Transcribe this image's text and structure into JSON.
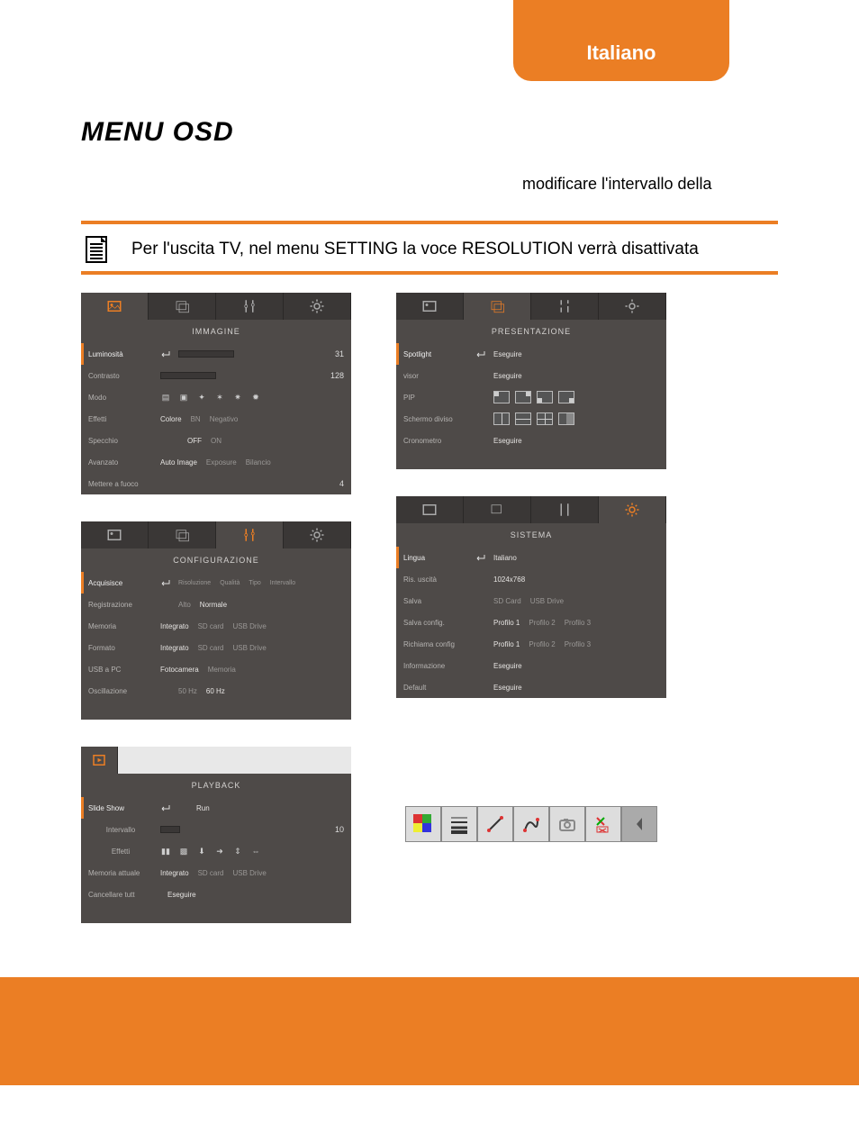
{
  "header": {
    "lang": "Italiano",
    "title": "MENU OSD",
    "rtext": "modificare l'intervallo della"
  },
  "info": {
    "text": "Per l'uscita TV, nel menu SETTING la voce RESOLUTION verrà disattivata"
  },
  "immagine": {
    "title": "IMMAGINE",
    "labels": {
      "lum": "Luminosità",
      "con": "Contrasto",
      "modo": "Modo",
      "eff": "Effetti",
      "spec": "Specchio",
      "av": "Avanzato",
      "foc": "Mettere a fuoco"
    },
    "vals": {
      "lum": "31",
      "con": "128",
      "eff": [
        "Colore",
        "BN",
        "Negativo"
      ],
      "spec": [
        "OFF",
        "ON"
      ],
      "av": [
        "Auto Image",
        "Exposure",
        "Bilancio"
      ],
      "foc": "4"
    }
  },
  "presentazione": {
    "title": "PRESENTAZIONE",
    "labels": {
      "spot": "Spotlight",
      "visor": "visor",
      "pip": "PIP",
      "div": "Schermo diviso",
      "cron": "Cronometro"
    },
    "exec": "Eseguire"
  },
  "configurazione": {
    "title": "CONFIGURAZIONE",
    "labels": {
      "acq": "Acquisisce",
      "reg": "Registrazione",
      "mem": "Memoria",
      "for": "Formato",
      "usb": "USB a PC",
      "osc": "Oscillazione"
    },
    "vals": {
      "acq": [
        "Risoluzione",
        "Qualità",
        "Tipo",
        "Intervallo"
      ],
      "reg": [
        "Alto",
        "Normale"
      ],
      "mem": [
        "Integrato",
        "SD card",
        "USB Drive"
      ],
      "for": [
        "Integrato",
        "SD card",
        "USB Drive"
      ],
      "usb": [
        "Fotocamera",
        "Memoria"
      ],
      "osc": [
        "50 Hz",
        "60 Hz"
      ]
    }
  },
  "sistema": {
    "title": "SISTEMA",
    "labels": {
      "lin": "Lingua",
      "ris": "Ris. uscità",
      "sal": "Salva",
      "salc": "Salva config.",
      "ric": "Richiama config",
      "inf": "Informazione",
      "def": "Default"
    },
    "vals": {
      "lin": "Italiano",
      "ris": "1024x768",
      "sal": [
        "SD Card",
        "USB Drive"
      ],
      "salc": [
        "Profilo 1",
        "Profilo 2",
        "Profilo 3"
      ],
      "ric": [
        "Profilo 1",
        "Profilo 2",
        "Profilo 3"
      ]
    },
    "exec": "Eseguire"
  },
  "playback": {
    "title": "PLAYBACK",
    "labels": {
      "ss": "Slide Show",
      "int": "Intervallo",
      "eff": "Effetti",
      "mem": "Memoria attuale",
      "del": "Cancellare tutt"
    },
    "vals": {
      "ss": "Run",
      "int": "10",
      "mem": [
        "Integrato",
        "SD card",
        "USB Drive"
      ],
      "del": "Eseguire"
    }
  }
}
